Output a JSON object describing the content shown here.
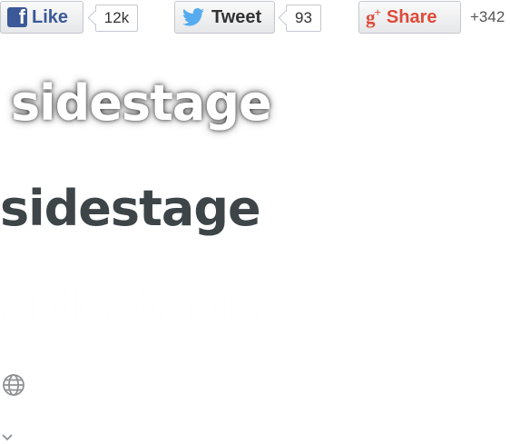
{
  "social": {
    "facebook": {
      "label": "Like",
      "count": "12k"
    },
    "twitter": {
      "label": "Tweet",
      "count": "93"
    },
    "googleplus": {
      "label": "Share",
      "count": "+342"
    }
  },
  "logos": [
    "sidestage",
    "sidestage",
    "sidestage"
  ],
  "icons": {
    "globe": "globe-icon",
    "chevron": "chevron-down-icon"
  },
  "colors": {
    "facebook": "#3b5998",
    "twitter": "#55acee",
    "googleplus": "#dd4b39",
    "logo_dark": "#3e4548"
  }
}
